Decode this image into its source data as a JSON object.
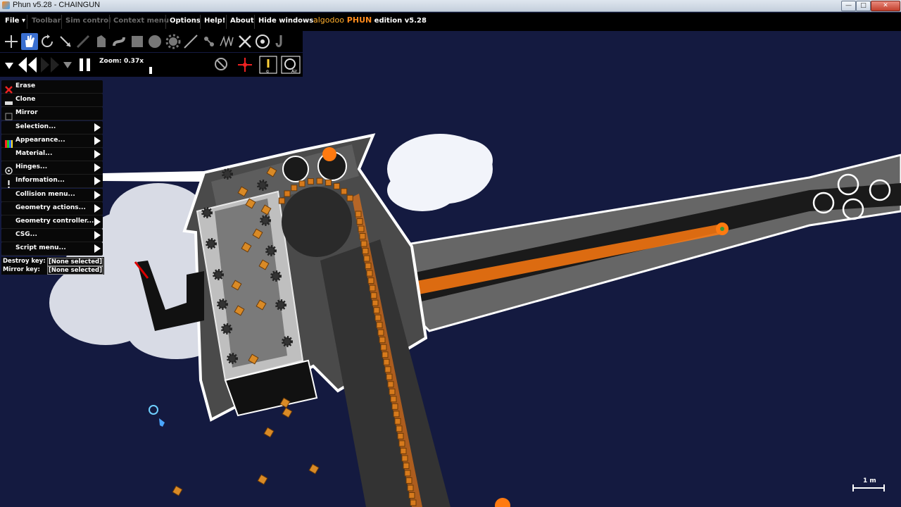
{
  "window": {
    "title": "Phun v5.28 - CHAINGUN",
    "minimize": "—",
    "maximize": "□",
    "close": "✕"
  },
  "menubar": {
    "file": "File ▾",
    "toolbar": "Toolbar",
    "sim_control": "Sim control",
    "context_menu": "Context menu",
    "options": "Options",
    "help": "Help!",
    "about": "About",
    "hide_windows": "Hide windows",
    "brand_algo": "algodoo",
    "brand_phun": "PHUN",
    "brand_edition": " edition v5.28"
  },
  "toolbar": {
    "tools": [
      "move-icon",
      "hand-icon",
      "rotate-icon",
      "scale-icon",
      "knife-icon",
      "sketch-icon",
      "brush-icon",
      "box-icon",
      "circle-icon",
      "gear-icon",
      "plane-icon",
      "chain-icon",
      "spring-icon",
      "fixate-icon",
      "hinge-icon",
      "tracer-icon"
    ],
    "active_tool": "hand-icon"
  },
  "sim": {
    "zoom_label": "Zoom: 0.37x",
    "zoom_value": 0.37
  },
  "context_menu": {
    "items": [
      {
        "label": "Erase",
        "icon": "erase-icon",
        "submenu": false
      },
      {
        "label": "Clone",
        "icon": "clone-icon",
        "submenu": false
      },
      {
        "label": "Mirror",
        "icon": "mirror-checkbox",
        "submenu": false
      },
      {
        "label": "Selection...",
        "icon": "",
        "submenu": true
      },
      {
        "label": "Appearance...",
        "icon": "appearance-icon",
        "submenu": true
      },
      {
        "label": "Material...",
        "icon": "",
        "submenu": true
      },
      {
        "label": "Hinges...",
        "icon": "hinge-icon",
        "submenu": true
      },
      {
        "label": "Information...",
        "icon": "info-icon",
        "submenu": true
      },
      {
        "label": "Collision menu...",
        "icon": "",
        "submenu": true
      },
      {
        "label": "Geometry actions...",
        "icon": "",
        "submenu": true
      },
      {
        "label": "Geometry controller...",
        "icon": "",
        "submenu": true
      },
      {
        "label": "CSG...",
        "icon": "",
        "submenu": true
      },
      {
        "label": "Script menu...",
        "icon": "",
        "submenu": true
      }
    ],
    "destroy_key_label": "Destroy key:",
    "destroy_key_value": "[None selected]",
    "mirror_key_label": "Mirror key:",
    "mirror_key_value": "[None selected]"
  },
  "scale_bar": {
    "label": "1 m"
  },
  "colors": {
    "background": "#141a40",
    "accent_orange": "#ff7a10",
    "chassis": "#5a5a5a"
  }
}
